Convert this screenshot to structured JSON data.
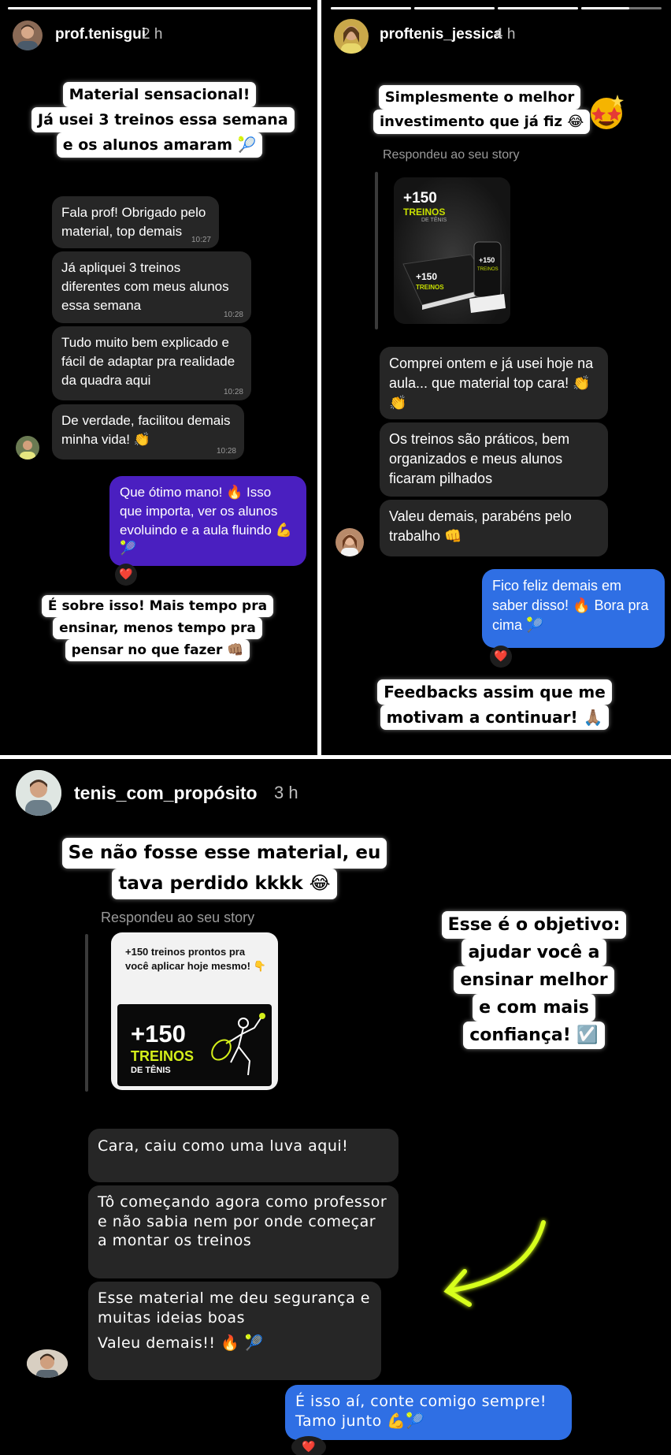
{
  "left_story": {
    "username": "prof.tenisgui",
    "time": "2 h",
    "caption_lines": [
      "Material sensacional!",
      "Já usei 3 treinos essa semana",
      "e os alunos amaram 🎾"
    ],
    "messages": [
      {
        "text": "Fala prof! Obrigado pelo material, top demais",
        "time": "10:27"
      },
      {
        "text": "Já apliquei 3 treinos diferentes com meus alunos essa semana",
        "time": "10:28"
      },
      {
        "text": "Tudo muito bem explicado e fácil de adaptar pra realidade da quadra aqui",
        "time": "10:28"
      },
      {
        "text": "De verdade, facilitou demais minha vida! 👏",
        "time": "10:28"
      }
    ],
    "reply": "Que ótimo mano! 🔥 Isso que importa, ver os alunos evoluindo e a aula fluindo 💪🎾",
    "reaction": "❤️",
    "footer_lines": [
      "É sobre isso! Mais tempo pra",
      "ensinar, menos tempo pra",
      "pensar no que fazer 👊🏽"
    ]
  },
  "right_story": {
    "username": "proftenis_jessica",
    "time": "4 h",
    "caption_lines": [
      "Simplesmente o melhor",
      "investimento que já fiz 😂"
    ],
    "sticker_icon": "star-struck-emoji",
    "replied_label": "Respondeu ao seu story",
    "story_thumb": {
      "big": "+150",
      "title": "TREINOS",
      "subtitle": "DE TÊNIS"
    },
    "messages": [
      "Comprei ontem e já usei hoje na aula... que material top cara! 👏👏",
      "Os treinos são práticos, bem organizados e meus alunos ficaram pilhados",
      "Valeu demais, parabéns pelo trabalho 👊"
    ],
    "reply": "Fico feliz demais em saber disso! 🔥 Bora pra cima 🎾",
    "reaction": "❤️",
    "footer_lines": [
      "Feedbacks assim que me",
      "motivam a continuar! 🙏🏽"
    ]
  },
  "bottom_story": {
    "username": "tenis_com_propósito",
    "time": "3 h",
    "caption_lines": [
      "Se não fosse esse material, eu",
      "tava perdido kkkk 😂"
    ],
    "replied_label": "Respondeu ao seu story",
    "story_card": {
      "top_text": "+150 treinos prontos pra você aplicar hoje mesmo! 👇",
      "big": "+150",
      "title": "TREINOS",
      "subtitle": "DE TÊNIS"
    },
    "messages": [
      "Cara, caiu como uma luva aqui!",
      "Tô começando agora como professor e não sabia nem por onde começar a montar os treinos",
      "Esse material me deu segurança e muitas ideias boas"
    ],
    "message_extra": "Valeu demais!! 🔥 🎾",
    "callout_lines": [
      "Esse é o objetivo:",
      "ajudar você a",
      "ensinar melhor",
      "e com mais",
      "confiança! ☑️"
    ],
    "reply": "É isso aí, conte comigo sempre! Tamo junto 💪🎾",
    "reaction": "❤️",
    "colors": {
      "sent_blue": "#2f6fe4",
      "sent_purple": "#5a1fc9",
      "arrow": "#d7ff1f"
    }
  }
}
